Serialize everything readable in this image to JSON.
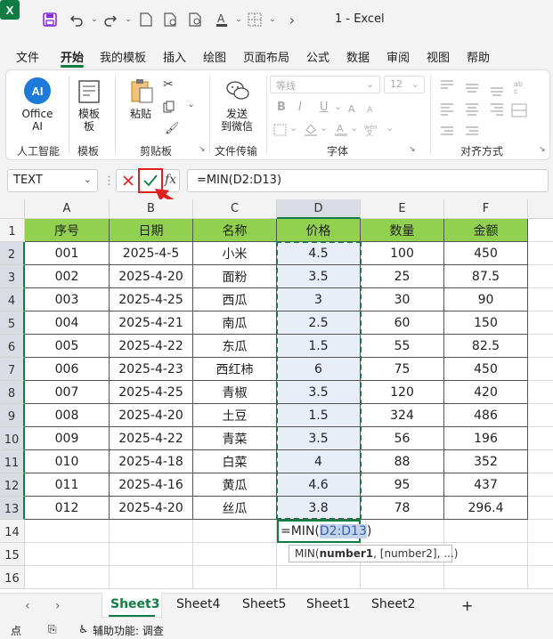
{
  "titlebar": {
    "title": "1  -  Excel",
    "logo": "X"
  },
  "menu": [
    "文件",
    "开始",
    "我的模板",
    "插入",
    "绘图",
    "页面布局",
    "公式",
    "数据",
    "审阅",
    "视图",
    "帮助"
  ],
  "ribbon": {
    "office_ai": "Office AI",
    "office_ai_badge": "AI",
    "group_ai": "人工智能",
    "template_btn": "模板",
    "template_btn2": "板",
    "group_template": "模板",
    "paste": "粘贴",
    "group_clipboard": "剪贴板",
    "send_wechat_1": "发送",
    "send_wechat_2": "到微信",
    "group_transfer": "文件传输",
    "font_name": "等线",
    "font_size": "12",
    "group_font": "字体",
    "group_align": "对齐方式",
    "bold": "B",
    "italic": "I",
    "underline": "U"
  },
  "formulabar": {
    "namebox": "TEXT",
    "formula": "=MIN(D2:D13)",
    "fx": "fx"
  },
  "columns": [
    "A",
    "B",
    "C",
    "D",
    "E",
    "F"
  ],
  "rows": [
    "1",
    "2",
    "3",
    "4",
    "5",
    "6",
    "7",
    "8",
    "9",
    "10",
    "11",
    "12",
    "13",
    "14",
    "15",
    "16"
  ],
  "headers": [
    "序号",
    "日期",
    "名称",
    "价格",
    "数量",
    "金额"
  ],
  "table": [
    [
      "001",
      "2025-4-5",
      "小米",
      "4.5",
      "100",
      "450"
    ],
    [
      "002",
      "2025-4-20",
      "面粉",
      "3.5",
      "25",
      "87.5"
    ],
    [
      "003",
      "2025-4-25",
      "西瓜",
      "3",
      "30",
      "90"
    ],
    [
      "004",
      "2025-4-21",
      "南瓜",
      "2.5",
      "60",
      "150"
    ],
    [
      "005",
      "2025-4-22",
      "东瓜",
      "1.5",
      "55",
      "82.5"
    ],
    [
      "006",
      "2025-4-23",
      "西红柿",
      "6",
      "75",
      "450"
    ],
    [
      "007",
      "2025-4-25",
      "青椒",
      "3.5",
      "120",
      "420"
    ],
    [
      "008",
      "2025-4-20",
      "土豆",
      "1.5",
      "324",
      "486"
    ],
    [
      "009",
      "2025-4-22",
      "青菜",
      "3.5",
      "56",
      "196"
    ],
    [
      "010",
      "2025-4-18",
      "白菜",
      "4",
      "88",
      "352"
    ],
    [
      "011",
      "2025-4-16",
      "黄瓜",
      "4.6",
      "95",
      "437"
    ],
    [
      "012",
      "2025-4-20",
      "丝瓜",
      "3.8",
      "78",
      "296.4"
    ]
  ],
  "editing_cell": {
    "prefix": "=MIN(",
    "ref": "D2:D13",
    "suffix": ")"
  },
  "tooltip": {
    "fn": "MIN(",
    "arg1": "number1",
    "rest": ", [number2], ...)"
  },
  "sheets": [
    "Sheet3",
    "Sheet4",
    "Sheet5",
    "Sheet1",
    "Sheet2"
  ],
  "add_sheet": "+",
  "status": {
    "mode": "点",
    "accessibility": "辅助功能: 调查"
  },
  "colors": {
    "accent": "#107c41",
    "header_fill": "#92d050",
    "selection": "#e8eef8",
    "red": "#e02020"
  }
}
